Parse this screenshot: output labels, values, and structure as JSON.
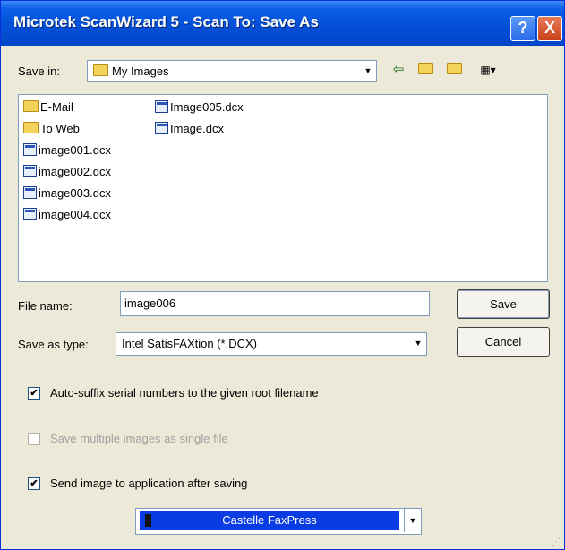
{
  "window": {
    "title": "Microtek ScanWizard 5 - Scan To: Save As"
  },
  "titlebar_buttons": {
    "help": "?",
    "close": "X"
  },
  "save_in": {
    "label": "Save in:",
    "folder": "My Images"
  },
  "toolbar": {
    "back_icon": "back-arrow-icon",
    "up_icon": "up-folder-icon",
    "new_folder_icon": "new-folder-icon",
    "view_icon": "view-menu-icon"
  },
  "files": {
    "col1": [
      "E-Mail",
      "To Web",
      "image001.dcx",
      "image002.dcx",
      "image003.dcx",
      "image004.dcx"
    ],
    "col2": [
      "Image005.dcx",
      "Image.dcx"
    ]
  },
  "file_name": {
    "label": "File name:",
    "value": "image006"
  },
  "save_type": {
    "label": "Save as type:",
    "value": "Intel SatisFAXtion (*.DCX)"
  },
  "buttons": {
    "save": "Save",
    "cancel": "Cancel"
  },
  "options": {
    "auto_suffix": {
      "label": "Auto-suffix serial numbers to the given root filename",
      "checked": true
    },
    "multiple": {
      "label": "Save multiple images as single file",
      "checked": false,
      "disabled": true
    },
    "send_app": {
      "label": "Send image to application after saving",
      "checked": true
    }
  },
  "application": {
    "value": "Castelle FaxPress"
  },
  "colors": {
    "titlebar": "#0450d8",
    "selection": "#0a3ce4",
    "dialog_bg": "#ece9d8"
  }
}
